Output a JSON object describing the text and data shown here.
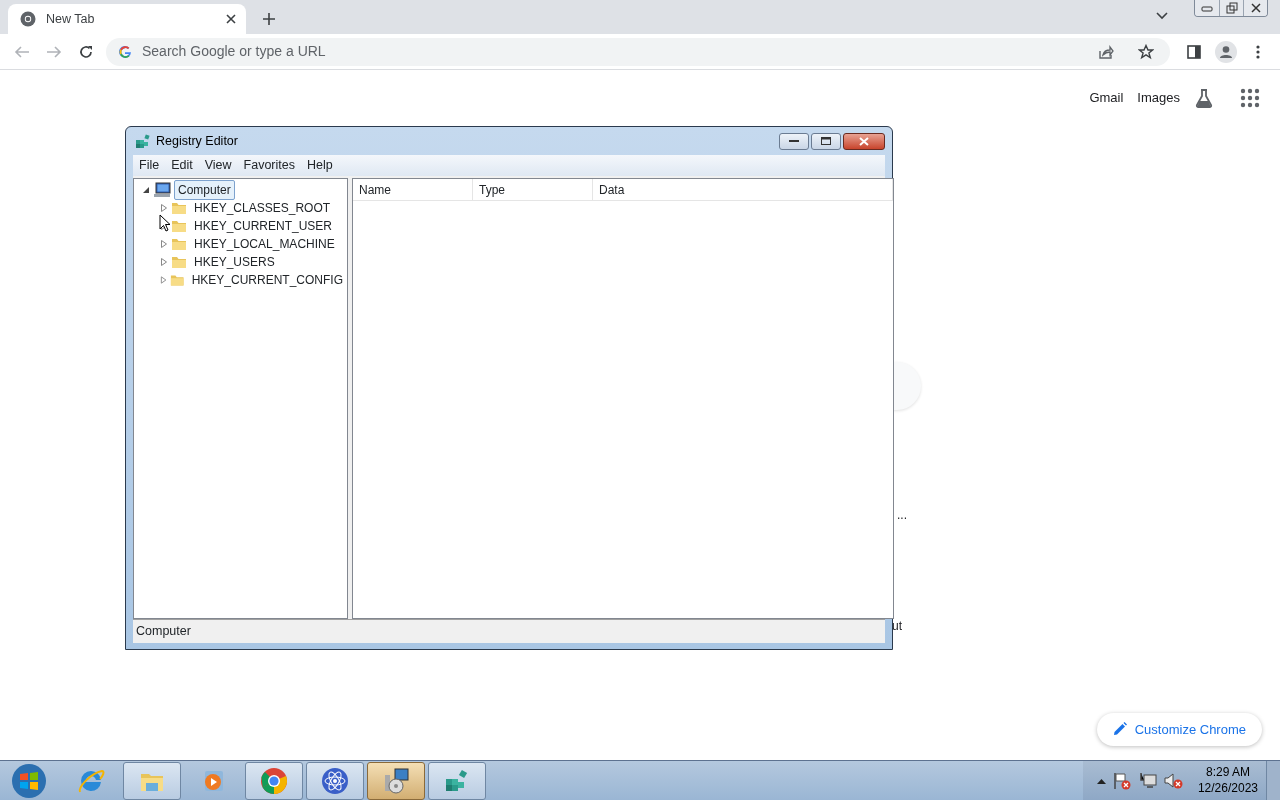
{
  "browser": {
    "tab": {
      "title": "New Tab",
      "selected": true
    },
    "address": {
      "placeholder": "Search Google or type a URL"
    },
    "links": [
      "Gmail",
      "Images"
    ],
    "peek_texts": [
      "...",
      "ut"
    ],
    "customize_button": "Customize Chrome"
  },
  "registry_editor": {
    "title": "Registry Editor",
    "menu": [
      "File",
      "Edit",
      "View",
      "Favorites",
      "Help"
    ],
    "tree": [
      {
        "label": "Computer",
        "kind": "computer",
        "expanded": true,
        "selected": true,
        "children": [
          {
            "label": "HKEY_CLASSES_ROOT",
            "kind": "folder",
            "expanded": false,
            "selected": false
          },
          {
            "label": "HKEY_CURRENT_USER",
            "kind": "folder",
            "expanded": false,
            "selected": false
          },
          {
            "label": "HKEY_LOCAL_MACHINE",
            "kind": "folder",
            "expanded": false,
            "selected": false
          },
          {
            "label": "HKEY_USERS",
            "kind": "folder",
            "expanded": false,
            "selected": false
          },
          {
            "label": "HKEY_CURRENT_CONFIG",
            "kind": "folder",
            "expanded": false,
            "selected": false
          }
        ]
      }
    ],
    "columns": [
      "Name",
      "Type",
      "Data"
    ],
    "status_bar": "Computer"
  },
  "taskbar": {
    "items": [
      {
        "kind": "ie",
        "running": false,
        "selected": false
      },
      {
        "kind": "explorer",
        "running": true,
        "selected": false
      },
      {
        "kind": "media",
        "running": false,
        "selected": false
      },
      {
        "kind": "chrome",
        "running": true,
        "selected": false
      },
      {
        "kind": "atom",
        "running": true,
        "selected": false
      },
      {
        "kind": "installer",
        "running": true,
        "selected": true
      },
      {
        "kind": "registry",
        "running": true,
        "selected": false
      }
    ],
    "clock": {
      "time": "8:29 AM",
      "date": "12/26/2023"
    }
  }
}
